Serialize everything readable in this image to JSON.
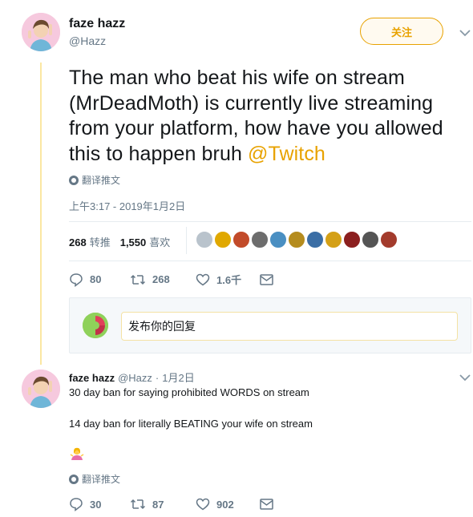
{
  "main_tweet": {
    "display_name": "faze hazz",
    "handle": "@Hazz",
    "follow_label": "关注",
    "text_parts": {
      "body": "The man who beat his wife on stream (MrDeadMoth) is currently live streaming from your platform, how have you allowed this to happen bruh ",
      "mention": "@Twitch"
    },
    "translate_label": "翻译推文",
    "timestamp": "上午3:17 - 2019年1月2日",
    "stats": {
      "retweets_count": "268",
      "retweets_label": "转推",
      "likes_count": "1,550",
      "likes_label": "喜欢"
    },
    "liker_avatar_colors": [
      "#b9c3cc",
      "#e0a800",
      "#c24b2a",
      "#6d6d6d",
      "#4a8fc2",
      "#b58c1e",
      "#3b6ea5",
      "#d4a017",
      "#8b1f1f",
      "#555555",
      "#a33b2c"
    ],
    "actions": {
      "replies": "80",
      "retweets": "268",
      "likes": "1.6千"
    },
    "reply_placeholder": "发布你的回复"
  },
  "reply_tweet": {
    "display_name": "faze hazz",
    "handle": "@Hazz",
    "separator": "·",
    "date": "1月2日",
    "line1": "30 day ban for saying prohibited WORDS on stream",
    "line2": "14 day ban for literally BEATING your wife on stream",
    "emoji_icon": "woman-shrugging-icon",
    "translate_label": "翻译推文",
    "actions": {
      "replies": "30",
      "retweets": "87",
      "likes": "902"
    }
  },
  "colors": {
    "accent": "#e8a200",
    "thread_line": "#fbe7a3",
    "muted_text": "#657786"
  }
}
